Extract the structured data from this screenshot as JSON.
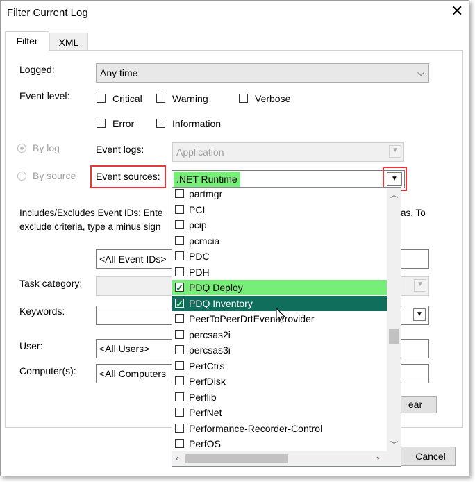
{
  "window": {
    "title": "Filter Current Log",
    "close_icon": "close-icon"
  },
  "tabs": [
    {
      "label": "Filter"
    },
    {
      "label": "XML"
    }
  ],
  "logged": {
    "label": "Logged:",
    "value": "Any time"
  },
  "event_level": {
    "label": "Event level:",
    "critical": "Critical",
    "warning": "Warning",
    "verbose": "Verbose",
    "error": "Error",
    "information": "Information"
  },
  "by_log": {
    "label": "By log",
    "event_logs_label": "Event logs:",
    "event_logs_value": "Application"
  },
  "by_source": {
    "label": "By source",
    "event_sources_label": "Event sources:",
    "event_sources_value": ".NET Runtime"
  },
  "includes_text_1": "Includes/Excludes Event IDs: Ente",
  "includes_text_1_end": "as. To",
  "includes_text_2": "exclude criteria, type a minus sign",
  "event_ids_placeholder": "<All Event IDs>",
  "task_category_label": "Task category:",
  "keywords_label": "Keywords:",
  "user": {
    "label": "User:",
    "value": "<All Users>"
  },
  "computer": {
    "label": "Computer(s):",
    "value": "<All Computers"
  },
  "clear_button": "ear",
  "cancel_button": "Cancel",
  "dropdown": {
    "items": [
      {
        "label": "partmgr",
        "checked": false
      },
      {
        "label": "PCI",
        "checked": false
      },
      {
        "label": "pcip",
        "checked": false
      },
      {
        "label": "pcmcia",
        "checked": false
      },
      {
        "label": "PDC",
        "checked": false
      },
      {
        "label": "PDH",
        "checked": false
      },
      {
        "label": "PDQ Deploy",
        "checked": true
      },
      {
        "label": "PDQ Inventory",
        "checked": true
      },
      {
        "label": "PeerToPeerDrtEventProvider",
        "checked": false
      },
      {
        "label": "percsas2i",
        "checked": false
      },
      {
        "label": "percsas3i",
        "checked": false
      },
      {
        "label": "PerfCtrs",
        "checked": false
      },
      {
        "label": "PerfDisk",
        "checked": false
      },
      {
        "label": "Perflib",
        "checked": false
      },
      {
        "label": "PerfNet",
        "checked": false
      },
      {
        "label": "Performance-Recorder-Control",
        "checked": false
      },
      {
        "label": "PerfOS",
        "checked": false
      }
    ]
  },
  "colors": {
    "highlight_red": "#e8363a",
    "green_light": "#77ee77",
    "green_dark": "#0f6e5c"
  }
}
